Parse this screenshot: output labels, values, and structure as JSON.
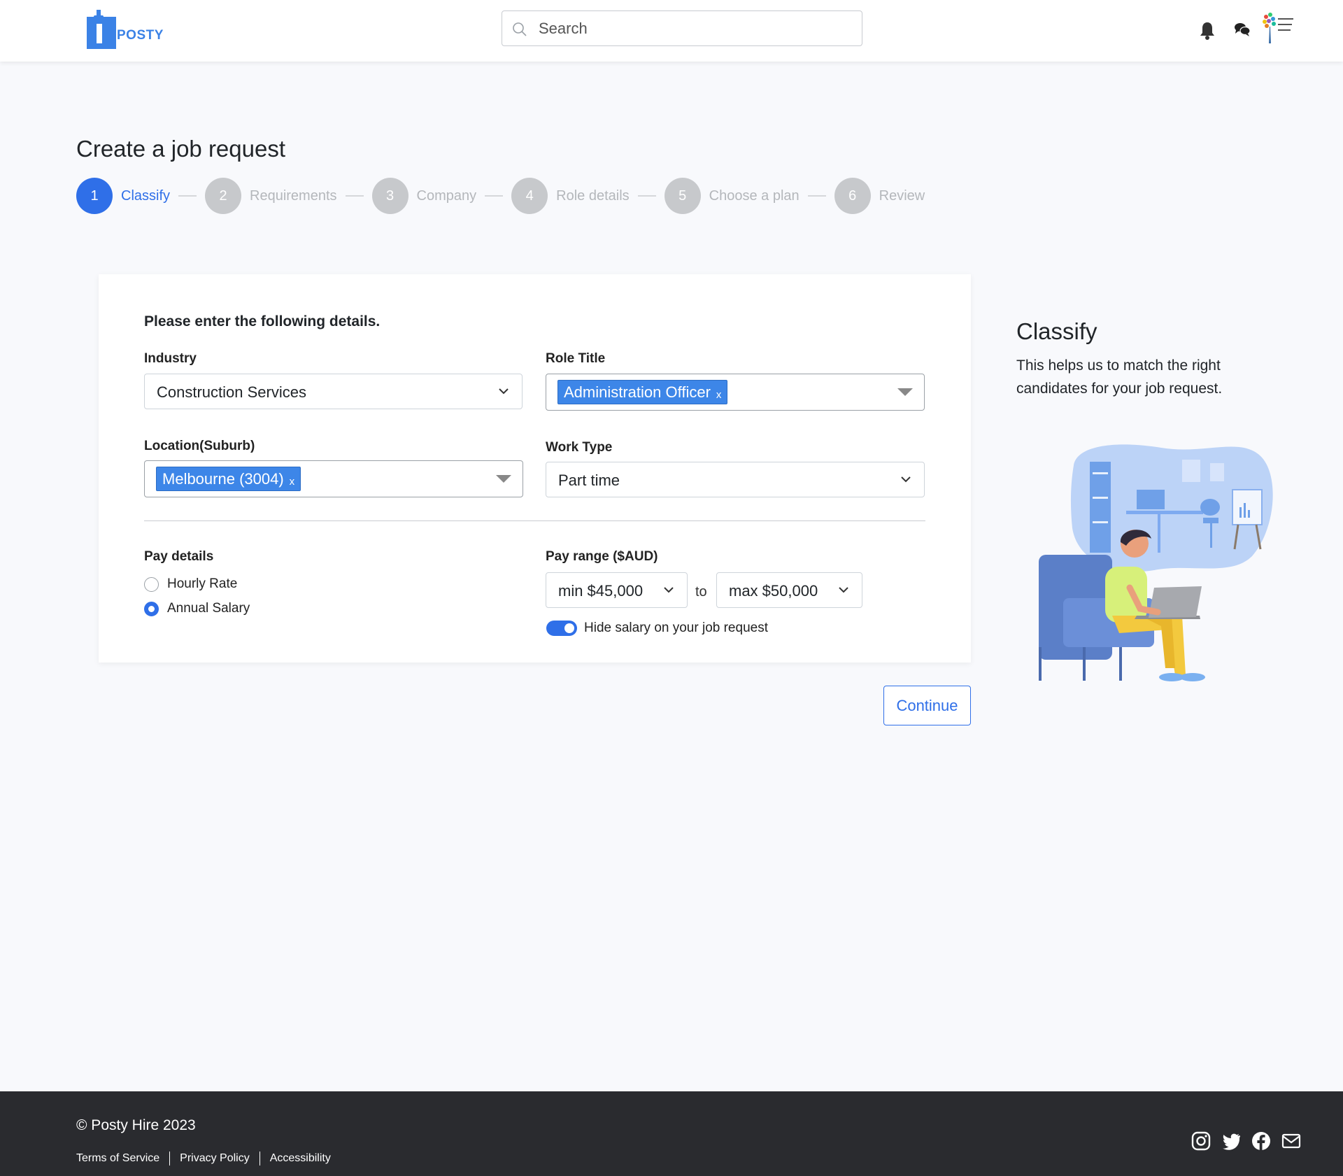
{
  "header": {
    "logo_text": "POSTY",
    "search_placeholder": "Search"
  },
  "page": {
    "title": "Create a job request"
  },
  "stepper": [
    {
      "num": "1",
      "label": "Classify",
      "active": true
    },
    {
      "num": "2",
      "label": "Requirements",
      "active": false
    },
    {
      "num": "3",
      "label": "Company",
      "active": false
    },
    {
      "num": "4",
      "label": "Role details",
      "active": false
    },
    {
      "num": "5",
      "label": "Choose a plan",
      "active": false
    },
    {
      "num": "6",
      "label": "Review",
      "active": false
    }
  ],
  "form": {
    "heading": "Please enter the following details.",
    "industry": {
      "label": "Industry",
      "value": "Construction Services"
    },
    "role_title": {
      "label": "Role Title",
      "chip": "Administration Officer",
      "chip_remove": "x"
    },
    "location": {
      "label": "Location(Suburb)",
      "chip": "Melbourne (3004)",
      "chip_remove": "x"
    },
    "work_type": {
      "label": "Work Type",
      "value": "Part time"
    },
    "pay_details": {
      "label": "Pay details",
      "options": [
        {
          "label": "Hourly Rate",
          "checked": false
        },
        {
          "label": "Annual Salary",
          "checked": true
        }
      ]
    },
    "pay_range": {
      "label": "Pay range ($AUD)",
      "min": "min $45,000",
      "separator": "to",
      "max": "max $50,000"
    },
    "hide_salary": {
      "label": "Hide salary on your job request",
      "on": true
    },
    "continue_label": "Continue"
  },
  "side": {
    "title": "Classify",
    "description": "This helps us to match the right candidates for your job request."
  },
  "footer": {
    "copyright": "© Posty Hire 2023",
    "links": [
      "Terms of Service",
      "Privacy Policy",
      "Accessibility"
    ],
    "social_icons": [
      "instagram-icon",
      "twitter-icon",
      "facebook-icon",
      "mail-icon"
    ]
  },
  "colors": {
    "primary": "#2f6fe8",
    "chip": "#3d86e8",
    "footer_bg": "#2a2b2f",
    "page_bg": "#f8f9fc"
  }
}
